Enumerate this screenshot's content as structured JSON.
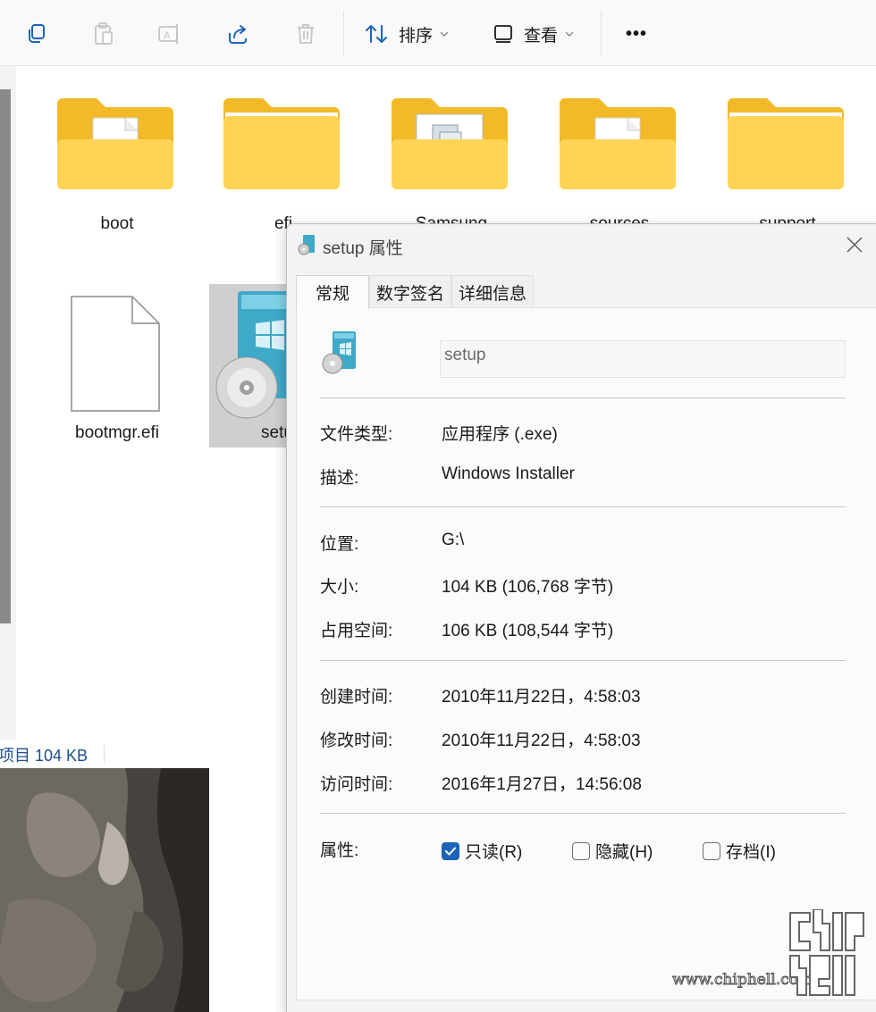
{
  "toolbar": {
    "buttons": {
      "copy": "copy-icon",
      "paste": "paste-icon",
      "rename": "rename-icon",
      "share": "share-icon",
      "delete": "delete-icon",
      "more": "more-icon"
    },
    "sort_label": "排序",
    "view_label": "查看",
    "more_label": "•••"
  },
  "explorer": {
    "items": [
      {
        "label": "boot",
        "type": "folder"
      },
      {
        "label": "efi",
        "type": "folder"
      },
      {
        "label": "Samsung",
        "type": "folder"
      },
      {
        "label": "sources",
        "type": "folder"
      },
      {
        "label": "support",
        "type": "folder"
      },
      {
        "label": "bootmgr.efi",
        "type": "file"
      },
      {
        "label": "setup",
        "type": "exe",
        "selected": true
      }
    ],
    "status": "项目 104 KB"
  },
  "dialog": {
    "title": "setup 属性",
    "tabs": [
      "常规",
      "数字签名",
      "详细信息"
    ],
    "active_tab": "常规",
    "file_name": "setup",
    "rows": [
      {
        "key": "文件类型:",
        "value": "应用程序 (.exe)"
      },
      {
        "key": "描述:",
        "value": "Windows Installer"
      },
      {
        "key": "位置:",
        "value": "G:\\"
      },
      {
        "key": "大小:",
        "value": "104 KB (106,768 字节)"
      },
      {
        "key": "占用空间:",
        "value": "106 KB (108,544 字节)"
      },
      {
        "key": "创建时间:",
        "value": "2010年11月22日，4:58:03"
      },
      {
        "key": "修改时间:",
        "value": "2010年11月22日，4:58:03"
      },
      {
        "key": "访问时间:",
        "value": "2016年1月27日，14:56:08"
      }
    ],
    "attributes_label": "属性:",
    "attributes": [
      {
        "label": "只读(R)",
        "checked": true
      },
      {
        "label": "隐藏(H)",
        "checked": false
      },
      {
        "label": "存档(I)",
        "checked": false
      }
    ],
    "accent": "#1d63b8"
  },
  "watermark": {
    "url": "www.chiphell.com"
  }
}
